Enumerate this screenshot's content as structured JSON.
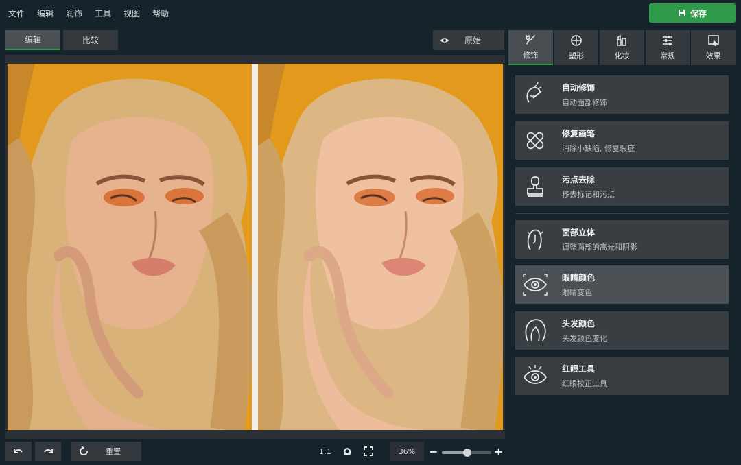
{
  "menu": [
    "文件",
    "编辑",
    "润饰",
    "工具",
    "视图",
    "帮助"
  ],
  "save_label": "保存",
  "view_tabs": [
    "编辑",
    "比较"
  ],
  "original_label": "原始",
  "bottom": {
    "reset_label": "重置",
    "ratio_label": "1:1",
    "zoom_value": "36%",
    "zoom_level": 0.52
  },
  "tool_tabs": [
    {
      "label": "修饰",
      "icon": "retouch-brush-icon"
    },
    {
      "label": "塑形",
      "icon": "reshape-icon"
    },
    {
      "label": "化妆",
      "icon": "makeup-icon"
    },
    {
      "label": "常规",
      "icon": "sliders-icon"
    },
    {
      "label": "效果",
      "icon": "effects-icon"
    }
  ],
  "cards": [
    {
      "title": "自动修饰",
      "sub": "自动面部修饰",
      "icon": "auto-retouch-face-icon"
    },
    {
      "title": "修复画笔",
      "sub": "消除小缺陷, 修复瑕疵",
      "icon": "bandage-icon"
    },
    {
      "title": "污点去除",
      "sub": "移去标记和污点",
      "icon": "stamp-icon"
    },
    {
      "title": "面部立体",
      "sub": "调整面部的高光和阴影",
      "icon": "face-contour-icon"
    },
    {
      "title": "眼睛颜色",
      "sub": "眼睛变色",
      "icon": "eye-color-icon"
    },
    {
      "title": "头发颜色",
      "sub": "头发颜色变化",
      "icon": "hair-color-icon"
    },
    {
      "title": "红眼工具",
      "sub": "红眼校正工具",
      "icon": "red-eye-icon"
    }
  ],
  "colors": {
    "accent": "#2f9a4a",
    "background": "#16232b",
    "photo_bg": "#e39a1c"
  }
}
